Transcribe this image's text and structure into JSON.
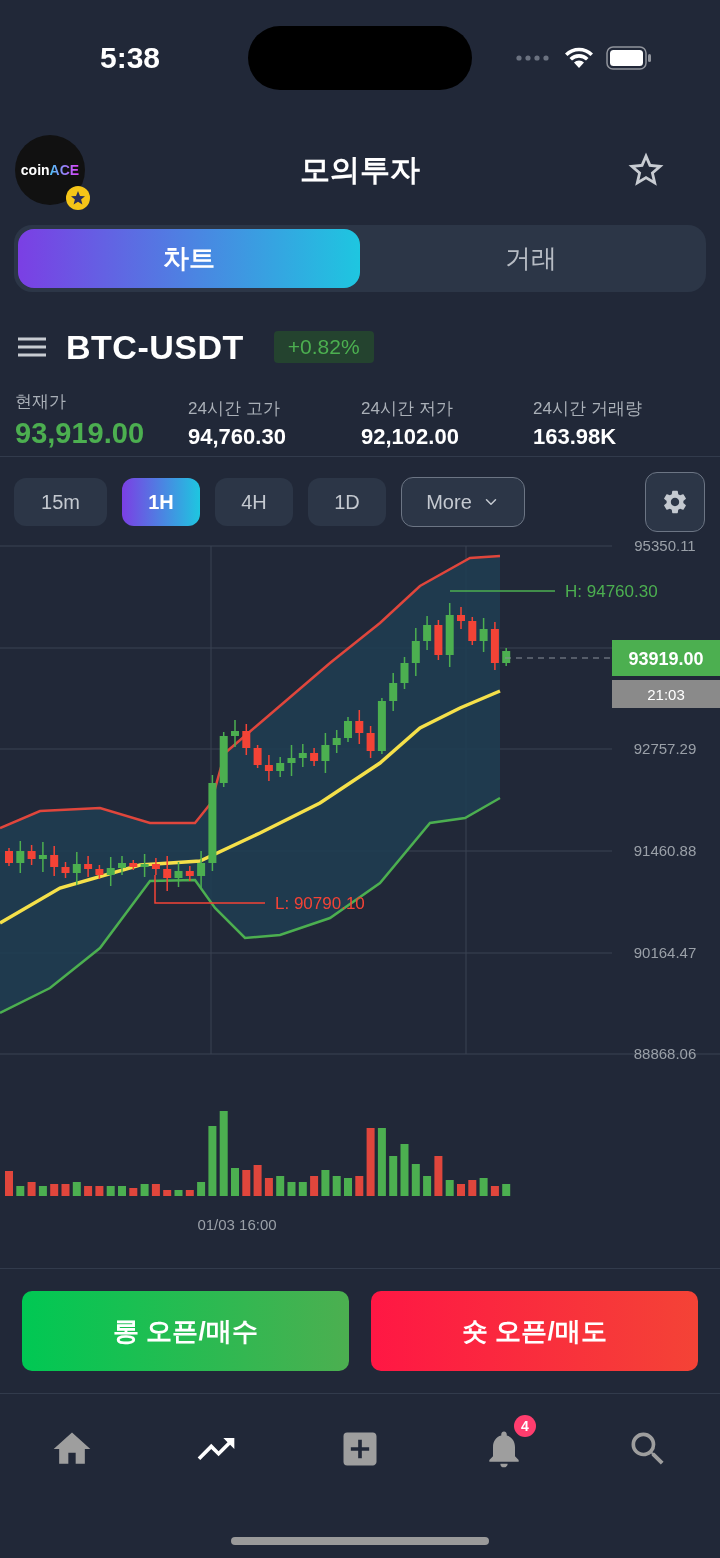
{
  "status_bar": {
    "time": "5:38"
  },
  "header": {
    "logo": {
      "prefix": "coin",
      "accent": "ACE"
    },
    "title": "모의투자"
  },
  "tabs": [
    {
      "label": "차트",
      "selected": true
    },
    {
      "label": "거래",
      "selected": false
    }
  ],
  "symbol": {
    "name": "BTC-USDT",
    "change": "+0.82%"
  },
  "stats": [
    {
      "label": "현재가",
      "value": "93,919.00",
      "kind": "current"
    },
    {
      "label": "24시간 고가",
      "value": "94,760.30",
      "kind": "plain"
    },
    {
      "label": "24시간 저가",
      "value": "92,102.00",
      "kind": "plain"
    },
    {
      "label": "24시간 거래량",
      "value": "163.98K",
      "kind": "plain"
    }
  ],
  "intervals": [
    {
      "label": "15m",
      "selected": false
    },
    {
      "label": "1H",
      "selected": true
    },
    {
      "label": "4H",
      "selected": false
    },
    {
      "label": "1D",
      "selected": false
    }
  ],
  "more": {
    "label": "More"
  },
  "chart": {
    "y_axis_labels": [
      "95350.11",
      "92757.29",
      "91460.88",
      "90164.47",
      "88868.06"
    ],
    "high_label": "H: 94760.30",
    "low_label": "L: 90790.10",
    "last_price": "93919.00",
    "countdown": "21:03",
    "date_label": "01/03 16:00"
  },
  "actions": [
    {
      "label": "롱 오픈/매수",
      "kind": "long"
    },
    {
      "label": "숏 오픈/매도",
      "kind": "short"
    }
  ],
  "nav": [
    {
      "kind": "home",
      "selected": false
    },
    {
      "kind": "trend",
      "selected": true
    },
    {
      "kind": "add",
      "selected": false
    },
    {
      "kind": "bell",
      "selected": false,
      "badge": "4"
    },
    {
      "kind": "search",
      "selected": false
    }
  ]
}
